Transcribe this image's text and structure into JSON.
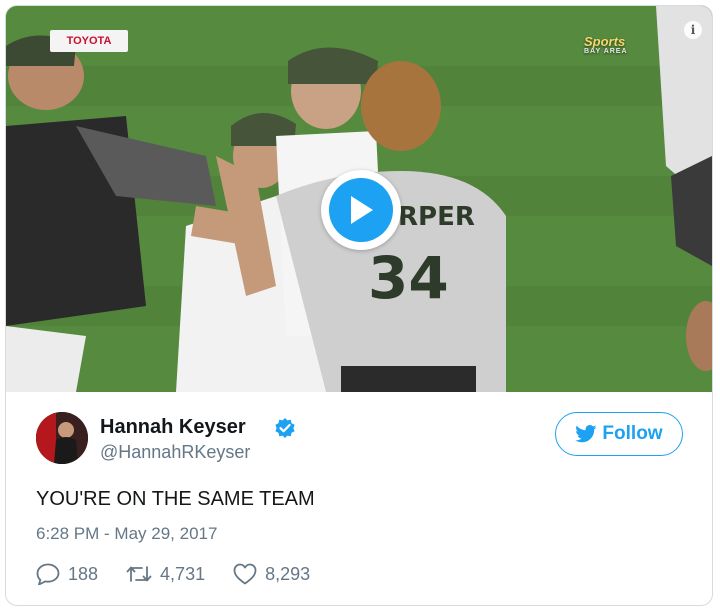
{
  "media": {
    "sponsor_label": "TOYOTA",
    "network_label": "Sports",
    "network_sublabel": "BAY AREA",
    "jersey_name": "RPER",
    "jersey_number": "34",
    "play_icon": "play-icon",
    "info_icon": "info-icon"
  },
  "tweet": {
    "user_name": "Hannah Keyser",
    "handle": "@HannahRKeyser",
    "verified_icon": "verified-badge-icon",
    "follow_label": "Follow",
    "text": "YOU'RE ON THE SAME TEAM",
    "timestamp": "6:28 PM - May 29, 2017",
    "replies": "188",
    "retweets": "4,731",
    "likes": "8,293"
  },
  "colors": {
    "accent": "#1da1f2",
    "text_primary": "#14171a",
    "text_secondary": "#657786",
    "border": "#d6dbe0"
  }
}
